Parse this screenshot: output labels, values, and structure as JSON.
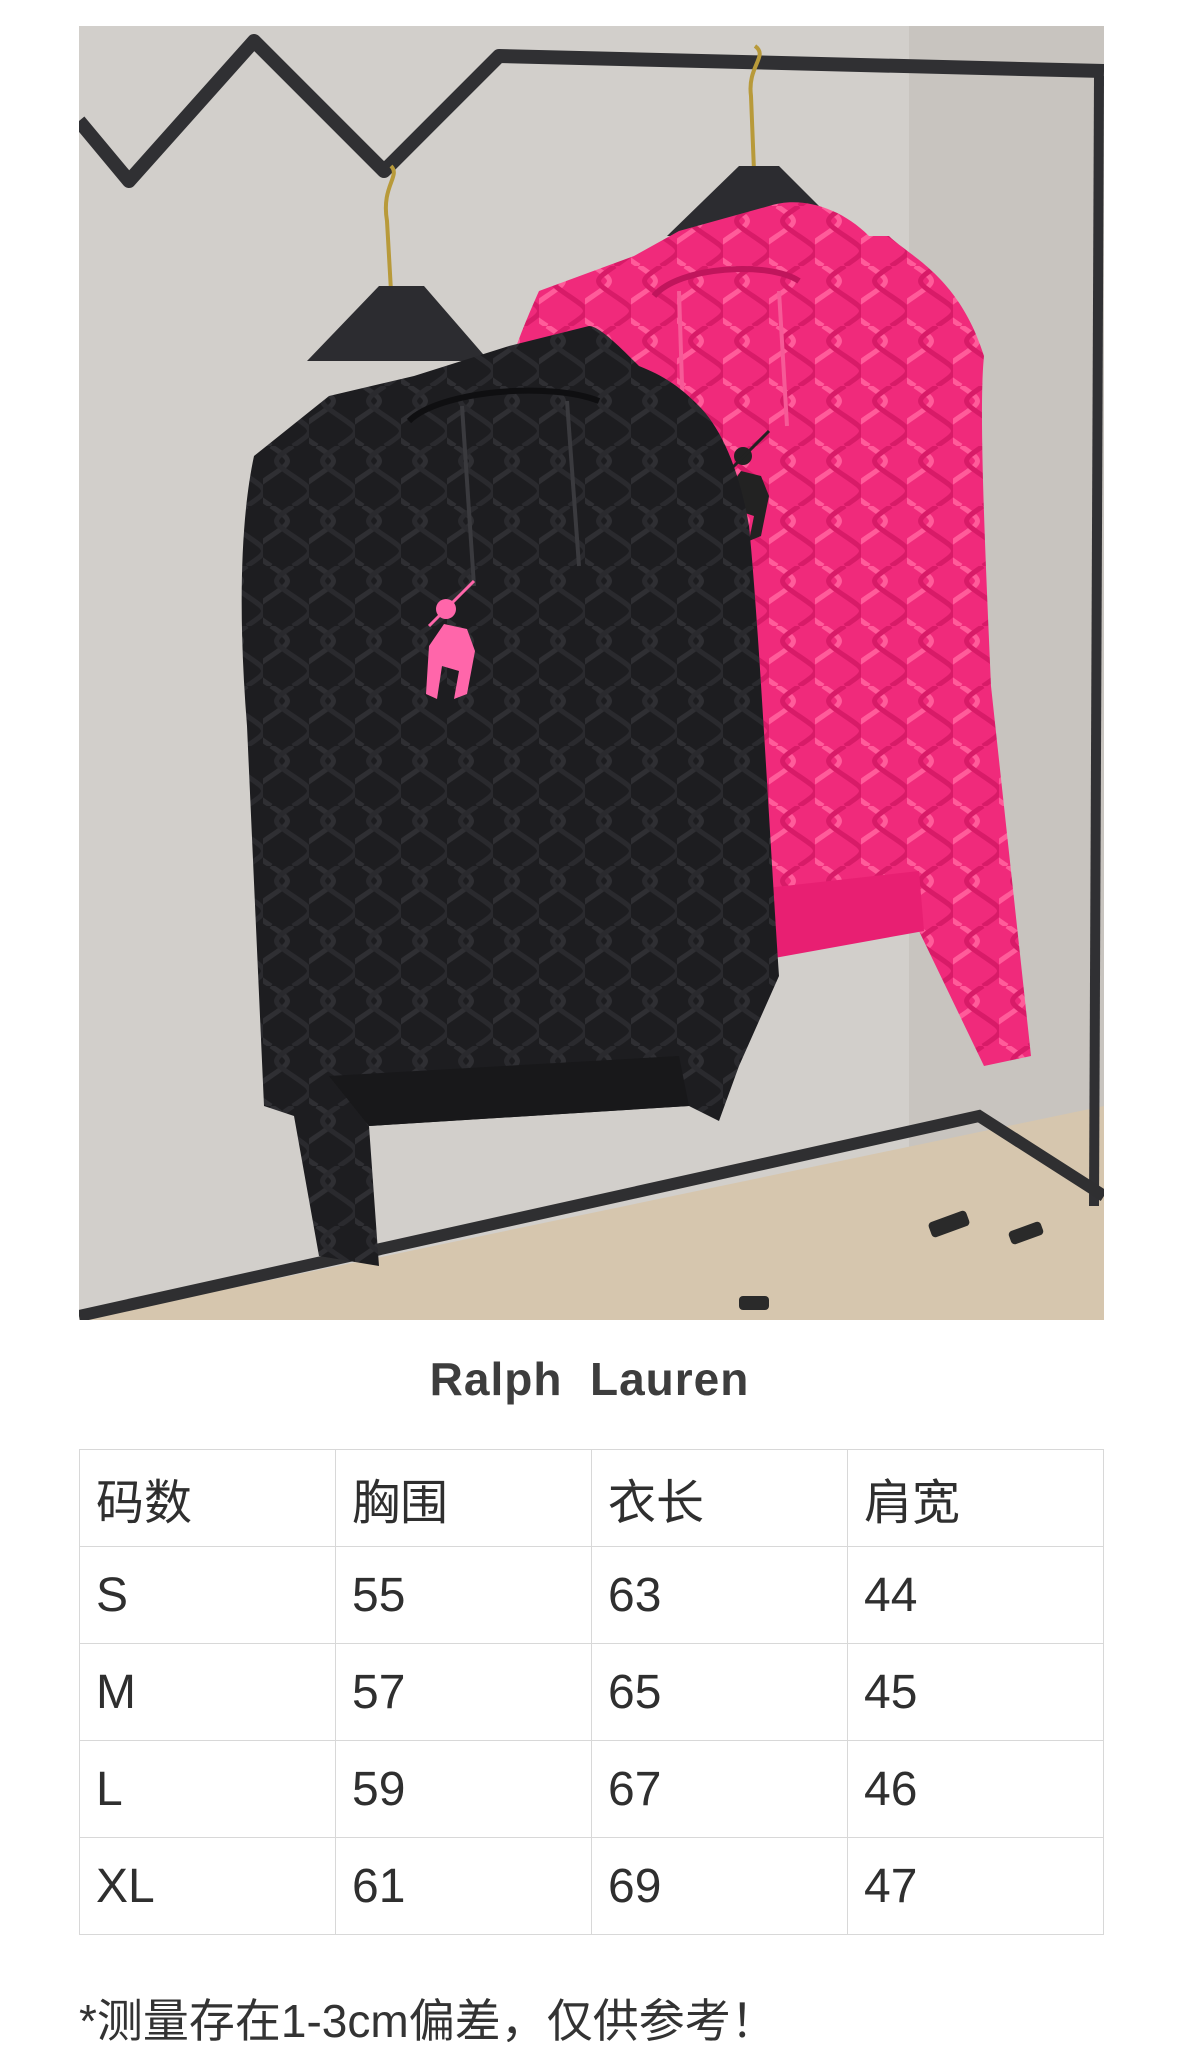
{
  "photo": {
    "subject": "product-photo",
    "colors": {
      "background_wall": "#cfccc8",
      "rack": "#2f2f31",
      "black_hoodie": "#1c1c1e",
      "pink_hoodie": "#f0287a",
      "logo_pink": "#ff66aa",
      "logo_black": "#222222"
    }
  },
  "brand_title": "Ralph  Lauren",
  "size_table": {
    "headers": [
      "码数",
      "胸围",
      "衣长",
      "肩宽"
    ],
    "rows": [
      [
        "S",
        "55",
        "63",
        "44"
      ],
      [
        "M",
        "57",
        "65",
        "45"
      ],
      [
        "L",
        "59",
        "67",
        "46"
      ],
      [
        "XL",
        "61",
        "69",
        "47"
      ]
    ]
  },
  "footnote": "*测量存在1-3cm偏差，仅供参考！"
}
